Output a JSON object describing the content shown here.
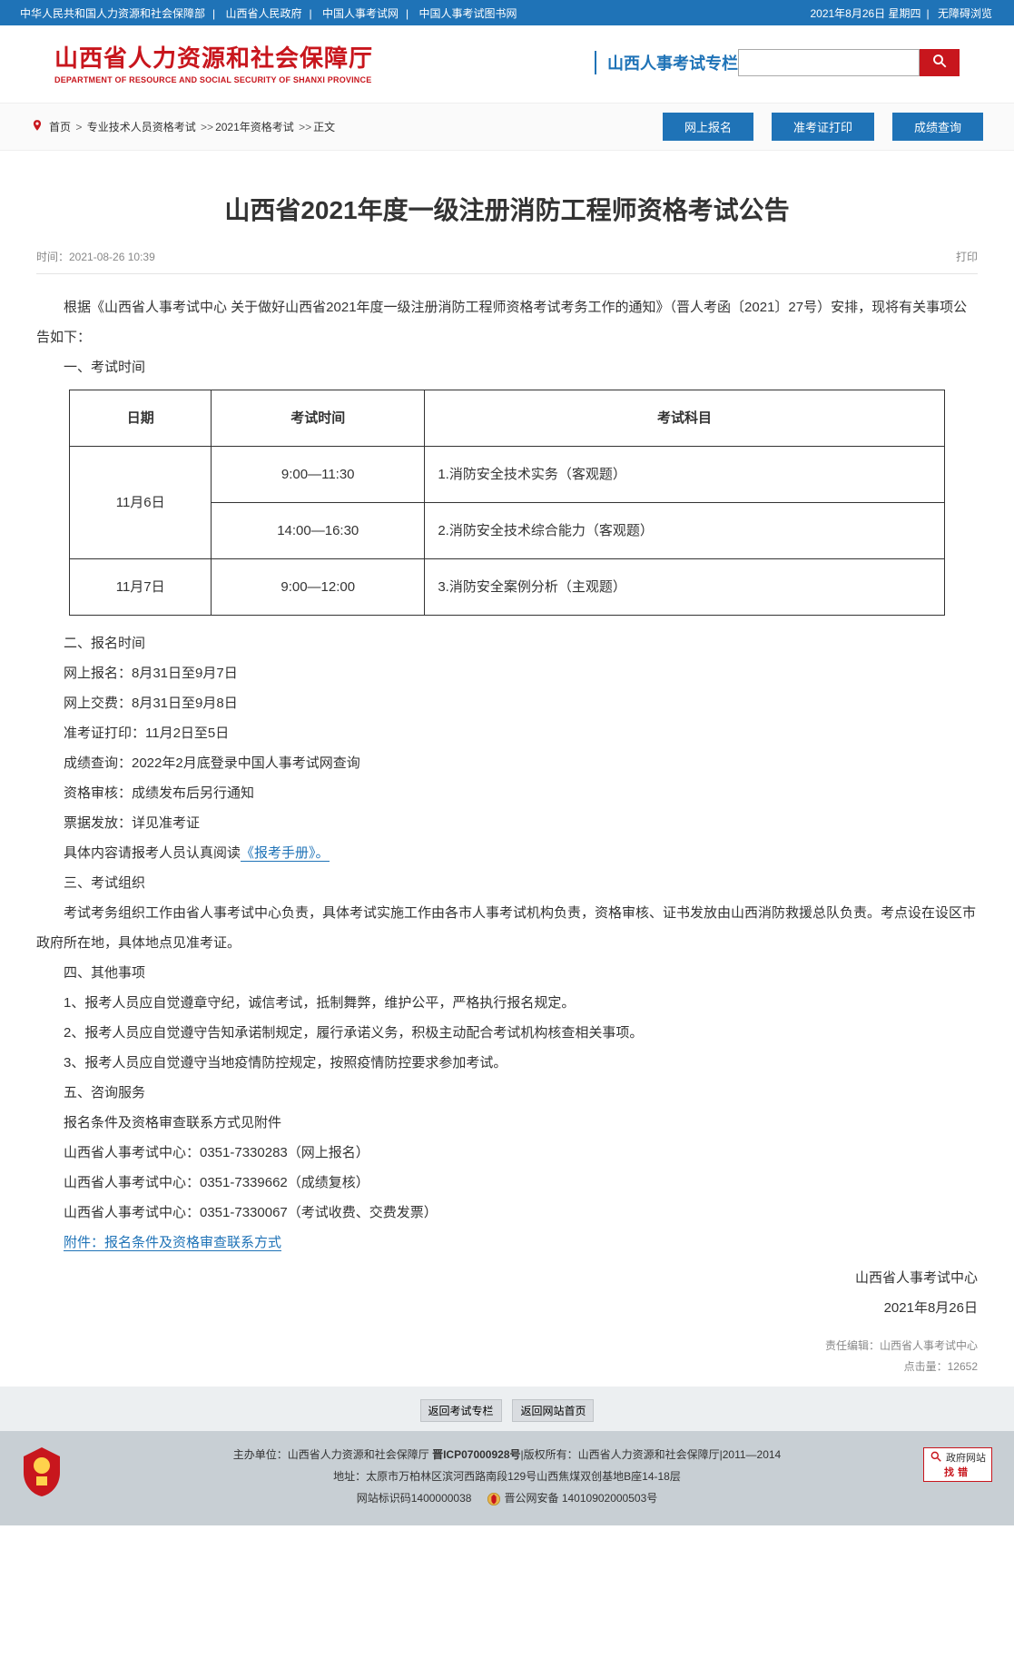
{
  "topbar": {
    "links": [
      "中华人民共和国人力资源和社会保障部",
      "山西省人民政府",
      "中国人事考试网",
      "中国人事考试图书网"
    ],
    "date": "2021年8月26日 星期四",
    "accessibility": "无障碍浏览"
  },
  "header": {
    "logo_cn": "山西省人力资源和社会保障厅",
    "logo_en": "DEPARTMENT OF RESOURCE AND SOCIAL SECURITY OF SHANXI PROVINCE",
    "column": "山西人事考试专栏"
  },
  "breadcrumb": {
    "items": [
      "首页",
      "专业技术人员资格考试",
      "2021年资格考试",
      "正文"
    ]
  },
  "action_buttons": [
    "网上报名",
    "准考证打印",
    "成绩查询"
  ],
  "article": {
    "title": "山西省2021年度一级注册消防工程师资格考试公告",
    "time_label": "时间：2021-08-26 10:39",
    "print": "打印",
    "intro_p1": "根据《山西省人事考试中心 关于做好山西省2021年度一级注册消防工程师资格考试考务工作的通知》（晋人考函〔2021〕27号）安排，现将有关事项公告如下：",
    "s1_title": "一、考试时间",
    "table": {
      "headers": [
        "日期",
        "考试时间",
        "考试科目"
      ],
      "rows": [
        {
          "date": "11月6日",
          "time": "9:00—11:30",
          "subject": "1.消防安全技术实务（客观题）"
        },
        {
          "date": "",
          "time": "14:00—16:30",
          "subject": "2.消防安全技术综合能力（客观题）"
        },
        {
          "date": "11月7日",
          "time": "9:00—12:00",
          "subject": "3.消防安全案例分析（主观题）"
        }
      ]
    },
    "s2_title": "二、报名时间",
    "s2_lines": [
      "网上报名：8月31日至9月7日",
      "网上交费：8月31日至9月8日",
      "准考证打印：11月2日至5日",
      "成绩查询：2022年2月底登录中国人事考试网查询",
      "资格审核：成绩发布后另行通知",
      "票据发放：详见准考证"
    ],
    "handbook_prefix": "具体内容请报考人员认真阅读",
    "handbook_link": "《报考手册》。",
    "s3_title": "三、考试组织",
    "s3_p": "考试考务组织工作由省人事考试中心负责，具体考试实施工作由各市人事考试机构负责，资格审核、证书发放由山西消防救援总队负责。考点设在设区市政府所在地，具体地点见准考证。",
    "s4_title": "四、其他事项",
    "s4_lines": [
      "1、报考人员应自觉遵章守纪，诚信考试，抵制舞弊，维护公平，严格执行报名规定。",
      "2、报考人员应自觉遵守告知承诺制规定，履行承诺义务，积极主动配合考试机构核查相关事项。",
      "3、报考人员应自觉遵守当地疫情防控规定，按照疫情防控要求参加考试。"
    ],
    "s5_title": "五、咨询服务",
    "s5_lines": [
      "报名条件及资格审查联系方式见附件",
      "山西省人事考试中心：0351-7330283（网上报名）",
      "山西省人事考试中心：0351-7339662（成绩复核）",
      "山西省人事考试中心：0351-7330067（考试收费、交费发票）"
    ],
    "attach_link": "附件：报名条件及资格审查联系方式",
    "signature_org": "山西省人事考试中心",
    "signature_date": "2021年8月26日",
    "editor_label": "责任编辑：山西省人事考试中心",
    "click_label": "点击量：12652"
  },
  "back_buttons": [
    "返回考试专栏",
    "返回网站首页"
  ],
  "footer": {
    "line1_prefix": "主办单位：山西省人力资源和社会保障厅 ",
    "icp": "晋ICP07000928号",
    "line1_suffix": "|版权所有：山西省人力资源和社会保障厅|2011—2014",
    "line2": "地址：太原市万柏林区滨河西路南段129号山西焦煤双创基地B座14-18层",
    "line3_a": "网站标识码1400000038",
    "line3_b": "晋公网安备 14010902000503号",
    "gov_label1": "政府网站",
    "gov_label2": "找错"
  }
}
